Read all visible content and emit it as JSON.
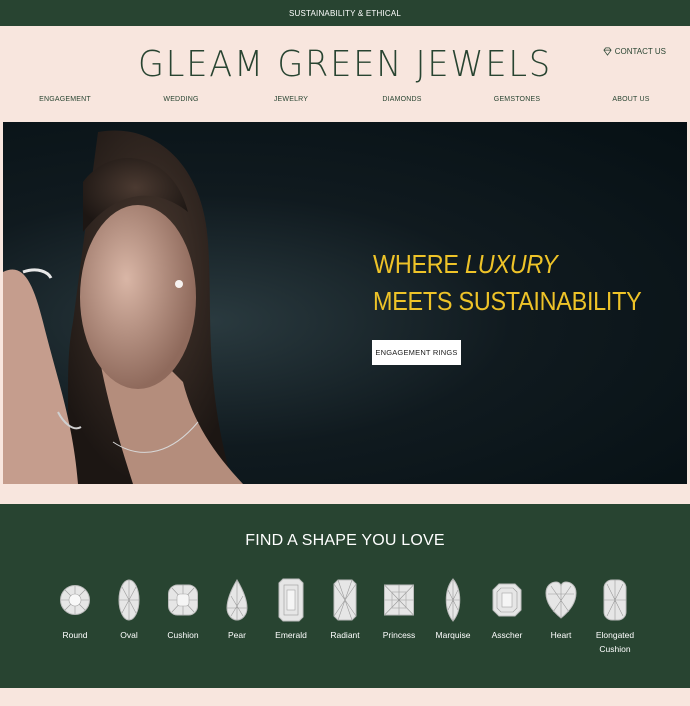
{
  "announcement": "SUSTAINABILITY & ETHICAL",
  "logo": "GLEAM GREEN JEWELS",
  "contact": {
    "label": "CONTACT US",
    "icon": "diamond-icon"
  },
  "nav": [
    "ENGAGEMENT",
    "WEDDING",
    "JEWELRY",
    "DIAMONDS",
    "GEMSTONES",
    "ABOUT US"
  ],
  "hero": {
    "line1_prefix": "WHERE ",
    "line1_em": "LUXURY",
    "line2": "MEETS SUSTAINABILITY",
    "cta": "ENGAGEMENT RINGS"
  },
  "shapes": {
    "title": "FIND A SHAPE YOU LOVE",
    "items": [
      {
        "label": "Round",
        "icon": "round-diamond-icon"
      },
      {
        "label": "Oval",
        "icon": "oval-diamond-icon"
      },
      {
        "label": "Cushion",
        "icon": "cushion-diamond-icon"
      },
      {
        "label": "Pear",
        "icon": "pear-diamond-icon"
      },
      {
        "label": "Emerald",
        "icon": "emerald-diamond-icon"
      },
      {
        "label": "Radiant",
        "icon": "radiant-diamond-icon"
      },
      {
        "label": "Princess",
        "icon": "princess-diamond-icon"
      },
      {
        "label": "Marquise",
        "icon": "marquise-diamond-icon"
      },
      {
        "label": "Asscher",
        "icon": "asscher-diamond-icon"
      },
      {
        "label": "Heart",
        "icon": "heart-diamond-icon"
      },
      {
        "label": "Elongated Cushion",
        "icon": "elongated-cushion-diamond-icon"
      }
    ]
  },
  "colors": {
    "brand_green": "#284431",
    "blush": "#f8e6de",
    "gold": "#eec328"
  }
}
